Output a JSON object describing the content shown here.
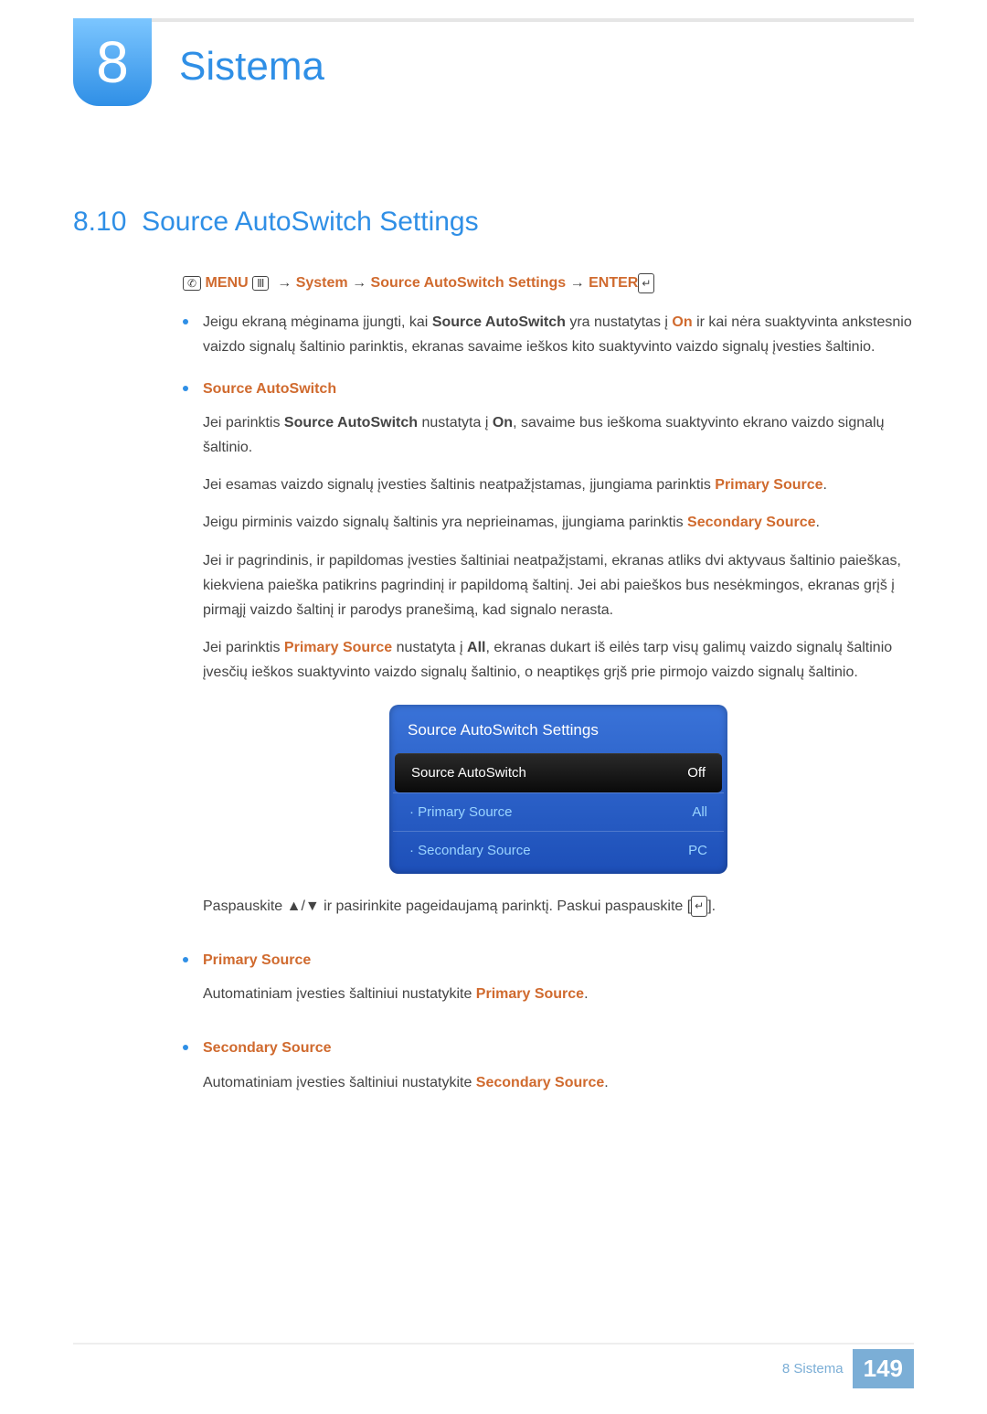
{
  "chapter": {
    "number": "8",
    "title": "Sistema"
  },
  "section": {
    "number": "8.10",
    "title": "Source AutoSwitch Settings"
  },
  "breadcrumb": {
    "menu": "MENU",
    "arrow": "→",
    "system": "System",
    "sas": "Source AutoSwitch Settings",
    "enter": "ENTER"
  },
  "bullet1": {
    "pre": "Jeigu ekraną mėginama įjungti, kai ",
    "hl1": "Source AutoSwitch",
    "mid": " yra nustatytas į ",
    "hl2": "On",
    "post": " ir kai nėra suaktyvinta ankstesnio vaizdo signalų šaltinio parinktis, ekranas savaime ieškos kito suaktyvinto vaizdo signalų įvesties šaltinio."
  },
  "sasBlock": {
    "title": "Source AutoSwitch",
    "p1a": "Jei parinktis ",
    "p1b": "Source AutoSwitch",
    "p1c": " nustatyta į ",
    "p1d": "On",
    "p1e": ", savaime bus ieškoma suaktyvinto ekrano vaizdo signalų šaltinio.",
    "p2a": "Jei esamas vaizdo signalų įvesties šaltinis neatpažįstamas, įjungiama parinktis ",
    "p2b": "Primary Source",
    "p2c": ".",
    "p3a": "Jeigu pirminis vaizdo signalų šaltinis yra neprieinamas, įjungiama parinktis ",
    "p3b": "Secondary Source",
    "p3c": ".",
    "p4": "Jei ir pagrindinis, ir papildomas įvesties šaltiniai neatpažįstami, ekranas atliks dvi aktyvaus šaltinio paieškas, kiekviena paieška patikrins pagrindinį ir papildomą šaltinį. Jei abi paieškos bus nesėkmingos, ekranas grįš į pirmąjį vaizdo šaltinį ir parodys pranešimą, kad signalo nerasta.",
    "p5a": "Jei parinktis ",
    "p5b": "Primary Source",
    "p5c": " nustatyta į ",
    "p5d": "All",
    "p5e": ", ekranas dukart iš eilės tarp visų galimų vaizdo signalų šaltinio įvesčių ieškos suaktyvinto vaizdo signalų šaltinio, o neaptikęs grįš prie pirmojo vaizdo signalų šaltinio."
  },
  "osd": {
    "title": "Source AutoSwitch Settings",
    "rows": [
      {
        "label": "Source AutoSwitch",
        "value": "Off"
      },
      {
        "label": "· Primary Source",
        "value": "All"
      },
      {
        "label": "· Secondary Source",
        "value": "PC"
      }
    ]
  },
  "navHint": {
    "pre": "Paspauskite ",
    "arrows": "▲/▼",
    "mid": " ir pasirinkite pageidaujamą parinktį. Paskui paspauskite [",
    "post": "]."
  },
  "primary": {
    "title": "Primary Source",
    "t1": "Automatiniam įvesties šaltiniui nustatykite ",
    "t2": "Primary Source",
    "t3": "."
  },
  "secondary": {
    "title": "Secondary Source",
    "t1": "Automatiniam įvesties šaltiniui nustatykite ",
    "t2": "Secondary Source",
    "t3": "."
  },
  "footer": {
    "label": "8 Sistema",
    "page": "149"
  }
}
